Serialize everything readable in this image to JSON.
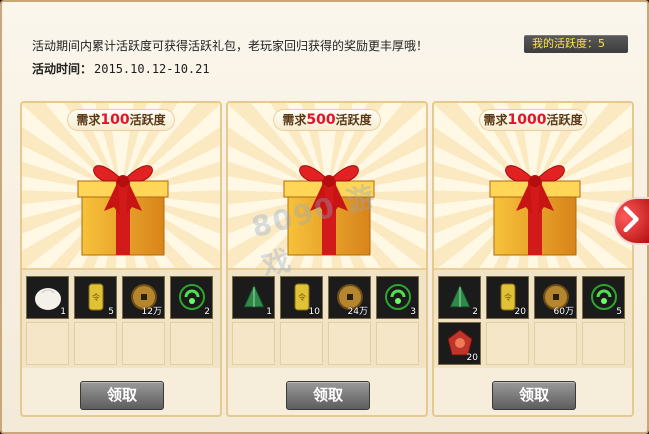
{
  "notice": "活动期间内累计活跃度可获得活跃礼包，老玩家回归获得的奖励更丰厚哦！",
  "time_label": "活动时间：",
  "time_value": "2015.10.12-10.21",
  "my_activity": "我的活跃度：5",
  "claim_label": "领取",
  "watermark": "8090 游戏",
  "cards": [
    {
      "req_prefix": "需求",
      "req_value": "100",
      "req_suffix": "活跃度",
      "items": [
        {
          "icon": "bun-icon",
          "count": "1"
        },
        {
          "icon": "gold-token-icon",
          "count": "5"
        },
        {
          "icon": "copper-coin-icon",
          "count": "12万"
        },
        {
          "icon": "green-orb-icon",
          "count": "2"
        }
      ]
    },
    {
      "req_prefix": "需求",
      "req_value": "500",
      "req_suffix": "活跃度",
      "items": [
        {
          "icon": "green-leaf-icon",
          "count": "1"
        },
        {
          "icon": "gold-token-icon",
          "count": "10"
        },
        {
          "icon": "copper-coin-icon",
          "count": "24万"
        },
        {
          "icon": "green-orb-icon",
          "count": "3"
        }
      ]
    },
    {
      "req_prefix": "需求",
      "req_value": "1000",
      "req_suffix": "活跃度",
      "items": [
        {
          "icon": "green-leaf-icon",
          "count": "2"
        },
        {
          "icon": "gold-token-icon",
          "count": "20"
        },
        {
          "icon": "copper-coin-icon",
          "count": "60万"
        },
        {
          "icon": "green-orb-icon",
          "count": "5"
        },
        {
          "icon": "red-gem-icon",
          "count": "20"
        }
      ]
    }
  ],
  "colors": {
    "accent_red": "#e0142b",
    "activity_text": "#ffe34a",
    "button_gray": "#777777"
  }
}
